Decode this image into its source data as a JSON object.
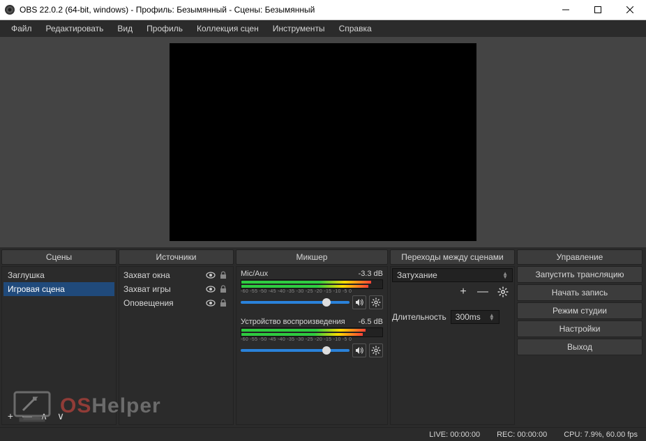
{
  "titlebar": {
    "title": "OBS 22.0.2 (64-bit, windows) - Профиль: Безымянный - Сцены: Безымянный"
  },
  "menu": {
    "file": "Файл",
    "edit": "Редактировать",
    "view": "Вид",
    "profile": "Профиль",
    "scene_collection": "Коллекция сцен",
    "tools": "Инструменты",
    "help": "Справка"
  },
  "panels": {
    "scenes_hdr": "Сцены",
    "sources_hdr": "Источники",
    "mixer_hdr": "Микшер",
    "transitions_hdr": "Переходы между сценами",
    "controls_hdr": "Управление"
  },
  "scenes": {
    "items": [
      {
        "label": "Заглушка",
        "selected": false
      },
      {
        "label": "Игровая сцена",
        "selected": true
      }
    ]
  },
  "scene_tools": {
    "add": "+",
    "remove": "—",
    "up": "∧",
    "down": "∨"
  },
  "sources": {
    "items": [
      {
        "label": "Захват окна"
      },
      {
        "label": "Захват игры"
      },
      {
        "label": "Оповещения"
      }
    ]
  },
  "mixer": {
    "ticks": "-60  -55  -50  -45  -40  -35  -30  -25  -20  -15  -10  -5  0",
    "ch1": {
      "name": "Mic/Aux",
      "level": "-3.3 dB",
      "meter_pct": 92,
      "slider_pct": 75
    },
    "ch2": {
      "name": "Устройство воспроизведения",
      "level": "-6.5 dB",
      "meter_pct": 88,
      "slider_pct": 75
    }
  },
  "transitions": {
    "selected": "Затухание",
    "duration_label": "Длительность",
    "duration_value": "300ms"
  },
  "controls": {
    "stream": "Запустить трансляцию",
    "record": "Начать запись",
    "studio": "Режим студии",
    "settings": "Настройки",
    "exit": "Выход"
  },
  "status": {
    "live": "LIVE: 00:00:00",
    "rec": "REC: 00:00:00",
    "cpu": "CPU: 7.9%, 60.00 fps"
  },
  "watermark": {
    "os": "OS",
    "helper": "Helper"
  }
}
